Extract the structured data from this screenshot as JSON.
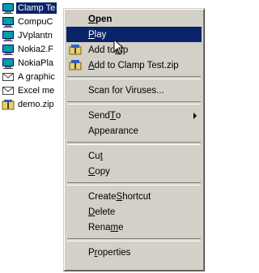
{
  "files": [
    {
      "label": "Clamp Te",
      "icon": "program-icon",
      "selected": true
    },
    {
      "label": "CompuC",
      "icon": "program-icon"
    },
    {
      "label": "JVplantn",
      "icon": "program-icon"
    },
    {
      "label": "Nokia2.F",
      "icon": "program-icon"
    },
    {
      "label": "NokiaPla",
      "icon": "program-icon"
    },
    {
      "label": "A graphic",
      "icon": "mail-icon"
    },
    {
      "label": "Excel me",
      "icon": "mail-icon"
    },
    {
      "label": "demo.zip",
      "icon": "zip-icon"
    }
  ],
  "menu": {
    "open": {
      "before": "",
      "key": "O",
      "after": "pen"
    },
    "play": {
      "before": "",
      "key": "P",
      "after": "lay"
    },
    "add_to_zip": {
      "before": "Add to ",
      "key": "Z",
      "after": "ip"
    },
    "add_to_named_zip": {
      "before": "",
      "key": "A",
      "after": "dd to Clamp Test.zip"
    },
    "scan": {
      "before": "Scan for Viruses...",
      "key": "",
      "after": ""
    },
    "send_to": {
      "before": "Send ",
      "key": "T",
      "after": "o"
    },
    "appearance": {
      "before": "Appearance",
      "key": "",
      "after": ""
    },
    "cut": {
      "before": "Cu",
      "key": "t",
      "after": ""
    },
    "copy": {
      "before": "",
      "key": "C",
      "after": "opy"
    },
    "create_shortcut": {
      "before": "Create ",
      "key": "S",
      "after": "hortcut"
    },
    "delete": {
      "before": "",
      "key": "D",
      "after": "elete"
    },
    "rename": {
      "before": "Rena",
      "key": "m",
      "after": "e"
    },
    "properties": {
      "before": "P",
      "key": "r",
      "after": "operties"
    }
  },
  "colors": {
    "highlight": "#0a246a",
    "menu_bg": "#d4d0c8"
  }
}
